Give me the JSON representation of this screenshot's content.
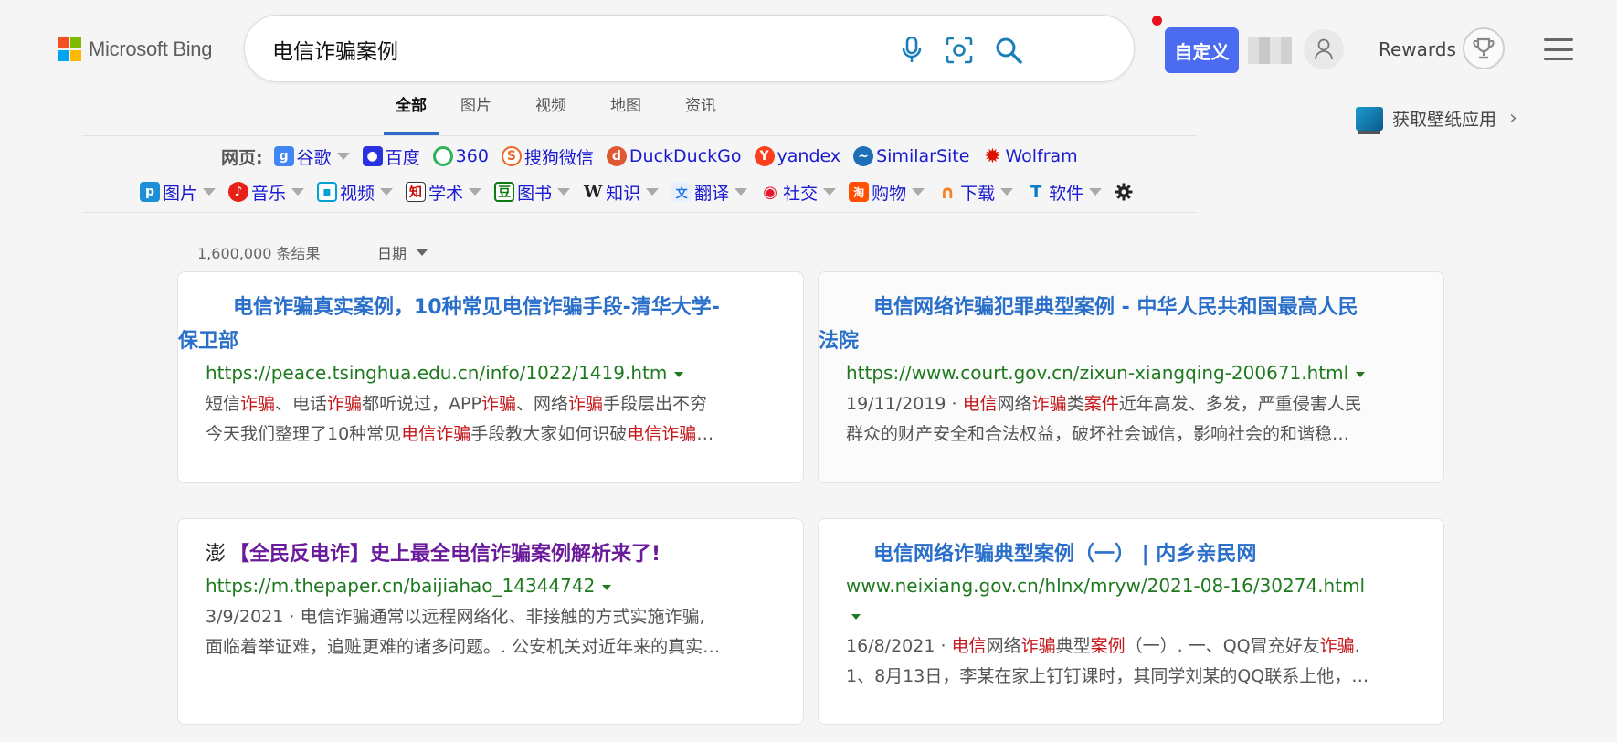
{
  "app": {
    "brand": "Microsoft Bing",
    "colors": {
      "accent": "#2e6ac9",
      "customize_bg": "#4b6cf0",
      "url_green": "#1f7a1f",
      "highlight_red": "#c4171a",
      "visited_purple": "#6a1a9a"
    }
  },
  "search": {
    "query": "电信诈骗案例"
  },
  "header": {
    "customize_label": "自定义",
    "rewards_label": "Rewards",
    "wallpaper_label": "获取壁纸应用"
  },
  "tabs": [
    {
      "label": "全部",
      "active": true
    },
    {
      "label": "图片",
      "active": false
    },
    {
      "label": "视频",
      "active": false
    },
    {
      "label": "地图",
      "active": false
    },
    {
      "label": "资讯",
      "active": false
    }
  ],
  "extension": {
    "row1_label": "网页:",
    "row1": [
      {
        "label": "谷歌",
        "icon": "google-icon",
        "has_dropdown": true
      },
      {
        "label": "百度",
        "icon": "baidu-icon",
        "has_dropdown": false
      },
      {
        "label": "360",
        "icon": "360-icon",
        "has_dropdown": false
      },
      {
        "label": "搜狗微信",
        "icon": "sogou-icon",
        "has_dropdown": false
      },
      {
        "label": "DuckDuckGo",
        "icon": "duckduckgo-icon",
        "has_dropdown": false
      },
      {
        "label": "yandex",
        "icon": "yandex-icon",
        "has_dropdown": false
      },
      {
        "label": "SimilarSite",
        "icon": "similarsite-icon",
        "has_dropdown": false
      },
      {
        "label": "Wolfram",
        "icon": "wolfram-icon",
        "has_dropdown": false
      }
    ],
    "row2": [
      {
        "label": "图片",
        "icon": "picture-icon"
      },
      {
        "label": "音乐",
        "icon": "music-icon"
      },
      {
        "label": "视频",
        "icon": "video-icon"
      },
      {
        "label": "学术",
        "icon": "academic-icon"
      },
      {
        "label": "图书",
        "icon": "book-icon"
      },
      {
        "label": "知识",
        "icon": "wiki-icon"
      },
      {
        "label": "翻译",
        "icon": "translate-icon"
      },
      {
        "label": "社交",
        "icon": "weibo-icon"
      },
      {
        "label": "购物",
        "icon": "shopping-icon"
      },
      {
        "label": "下载",
        "icon": "download-icon"
      },
      {
        "label": "软件",
        "icon": "software-icon"
      }
    ]
  },
  "results_meta": {
    "count": "1,600,000 条结果",
    "date_filter": "日期"
  },
  "results": [
    {
      "title_line1": "电信诈骗真实案例，10种常见电信诈骗手段-清华大学-",
      "title_line2": "保卫部",
      "url": "https://peace.tsinghua.edu.cn/info/1022/1419.htm",
      "snippet_line1": [
        [
          "短信",
          false
        ],
        [
          "诈骗",
          true
        ],
        [
          "、电话",
          false
        ],
        [
          "诈骗",
          true
        ],
        [
          "都听说过，APP",
          false
        ],
        [
          "诈骗",
          true
        ],
        [
          "、网络",
          false
        ],
        [
          "诈骗",
          true
        ],
        [
          "手段层出不穷",
          false
        ]
      ],
      "snippet_line2": [
        [
          "今天我们整理了10种常见",
          false
        ],
        [
          "电信诈骗",
          true
        ],
        [
          "手段教大家如何识破",
          false
        ],
        [
          "电信诈骗",
          true
        ],
        [
          "…",
          false
        ]
      ]
    },
    {
      "title_line1": "电信网络诈骗犯罪典型案例 - 中华人民共和国最高人民",
      "title_line2": "法院",
      "url": "https://www.court.gov.cn/zixun-xiangqing-200671.html",
      "snippet_line1": [
        [
          "19/11/2019 · ",
          false
        ],
        [
          "电信",
          true
        ],
        [
          "网络",
          false
        ],
        [
          "诈骗",
          true
        ],
        [
          "类",
          false
        ],
        [
          "案件",
          true
        ],
        [
          "近年高发、多发，严重侵害人民",
          false
        ]
      ],
      "snippet_line2": [
        [
          "群众的财产安全和合法权益，破坏社会诚信，影响社会的和谐稳…",
          false
        ]
      ]
    },
    {
      "title_line1": "【全民反电诈】史上最全电信诈骗案例解析来了!",
      "url": "https://m.thepaper.cn/baijiahao_14344742",
      "snippet_line1": [
        [
          "3/9/2021 · 电信诈骗通常以远程网络化、非接触的方式实施诈骗,",
          false
        ]
      ],
      "snippet_line2": [
        [
          "面临着举证难，追赃更难的诸多问题。. 公安机关对近年来的真实…",
          false
        ]
      ]
    },
    {
      "title_line1": "电信网络诈骗典型案例（一） | 内乡亲民网",
      "url": "www.neixiang.gov.cn/hlnx/mryw/2021-08-16/30274.html",
      "snippet_line1": [
        [
          "16/8/2021 · ",
          false
        ],
        [
          "电信",
          true
        ],
        [
          "网络",
          false
        ],
        [
          "诈骗",
          true
        ],
        [
          "典型",
          false
        ],
        [
          "案例",
          true
        ],
        [
          "（一）. 一、QQ冒充好友",
          false
        ],
        [
          "诈骗",
          true
        ],
        [
          ".",
          false
        ]
      ],
      "snippet_line2": [
        [
          "1、8月13日，李某在家上钉钉课时，其同学刘某的QQ联系上他，…",
          false
        ]
      ]
    }
  ]
}
